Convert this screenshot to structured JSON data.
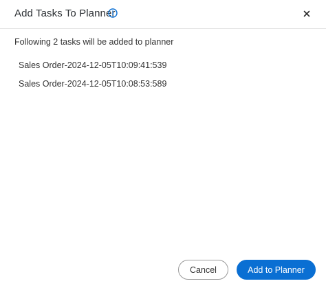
{
  "dialog": {
    "title": "Add Tasks To Planner",
    "info_icon": "info-circle-icon",
    "close_icon": "close-x-icon",
    "close_symbol": "✕"
  },
  "body": {
    "intro": "Following 2 tasks will be added to planner",
    "tasks": [
      "Sales Order-2024-12-05T10:09:41:539",
      "Sales Order-2024-12-05T10:08:53:589"
    ]
  },
  "footer": {
    "cancel_label": "Cancel",
    "submit_label": "Add to Planner"
  },
  "colors": {
    "accent": "#0a6fd3",
    "text": "#333333",
    "divider": "#e6e6e6",
    "cancel_border": "#9a9a9a"
  }
}
